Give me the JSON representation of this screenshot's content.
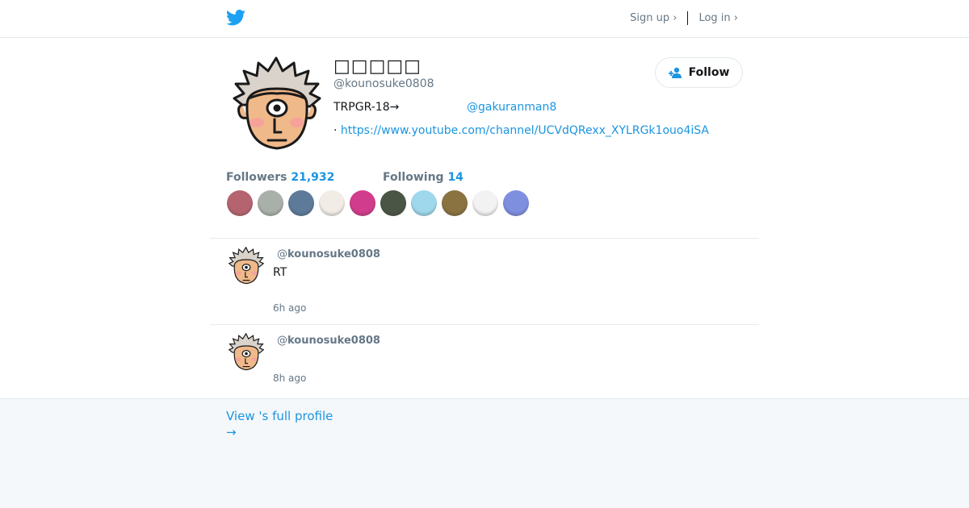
{
  "nav": {
    "signup": "Sign up ›",
    "login": "Log in ›"
  },
  "profile": {
    "name": "□□□□□",
    "handle": "@kounosuke0808",
    "bio_text": "TRPGR-18→",
    "bio_mention": "@gakuranman8",
    "url_prefix": "· ",
    "url": "https://www.youtube.com/channel/UCVdQRexx_XYLRGk1ouo4iSA",
    "follow_label": "Follow"
  },
  "stats": {
    "followers_label": "Followers",
    "followers_count": "21,932",
    "following_label": "Following",
    "following_count": "14"
  },
  "following_avatars": [
    {
      "name": "avatar-1",
      "color": "#b5646f"
    },
    {
      "name": "avatar-2",
      "color": "#a9b0aa"
    },
    {
      "name": "avatar-3",
      "color": "#5d7a99"
    },
    {
      "name": "avatar-4",
      "color": "#f1ece5"
    },
    {
      "name": "avatar-5",
      "color": "#d23c8c"
    },
    {
      "name": "avatar-6",
      "color": "#4a5546"
    },
    {
      "name": "avatar-7",
      "color": "#9fd8ec"
    },
    {
      "name": "avatar-8",
      "color": "#8a7340"
    },
    {
      "name": "avatar-9",
      "color": "#f2f2f2"
    },
    {
      "name": "avatar-10",
      "color": "#7f8fe0"
    }
  ],
  "tweets": [
    {
      "at": "@",
      "handle": "kounosuke0808",
      "text": "RT",
      "time": "6h ago"
    },
    {
      "at": "@",
      "handle": "kounosuke0808",
      "text": "",
      "time": "8h ago"
    }
  ],
  "footer": {
    "full_profile_line1": "View 's full profile",
    "full_profile_line2": "→"
  },
  "colors": {
    "accent": "#1b95e0",
    "muted": "#657786",
    "footer_bg": "#f5f8fa"
  },
  "icons": {
    "logo": "twitter-bird-icon",
    "follow": "add-user-icon"
  }
}
